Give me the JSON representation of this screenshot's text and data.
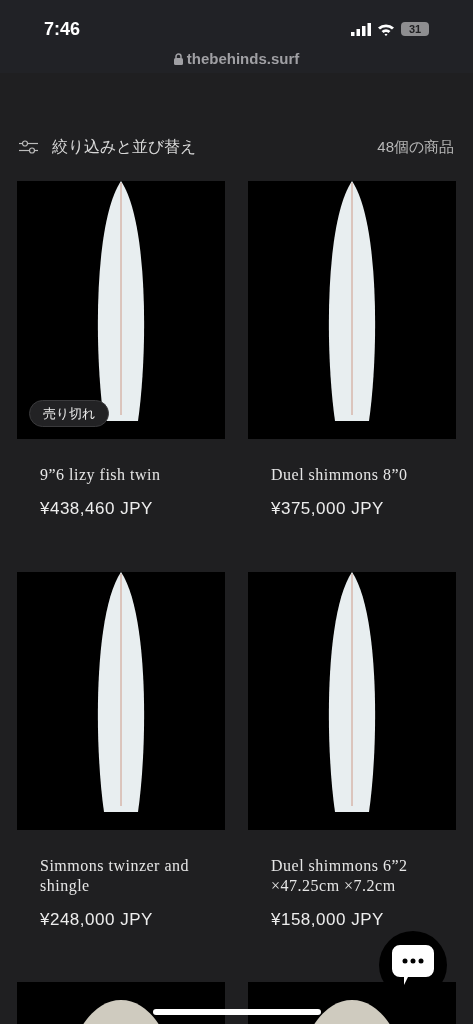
{
  "status_bar": {
    "time": "7:46",
    "battery": "31"
  },
  "address_bar": {
    "url": "thebehinds.surf"
  },
  "toolbar": {
    "filter_label": "絞り込みと並び替え",
    "count": "48個の商品"
  },
  "products": [
    {
      "kind": "full",
      "name": "9”6 lizy fish twin",
      "price": "¥438,460 JPY",
      "badge": "売り切れ"
    },
    {
      "kind": "full",
      "name": "Duel shimmons 8”0",
      "price": "¥375,000 JPY"
    },
    {
      "kind": "full",
      "name": "Simmons twinzer and shingle",
      "price": "¥248,000 JPY"
    },
    {
      "kind": "full",
      "name": "Duel shimmons 6”2 ×47.25cm ×7.2cm",
      "price": "¥158,000 JPY"
    },
    {
      "kind": "partial"
    },
    {
      "kind": "partial"
    }
  ]
}
